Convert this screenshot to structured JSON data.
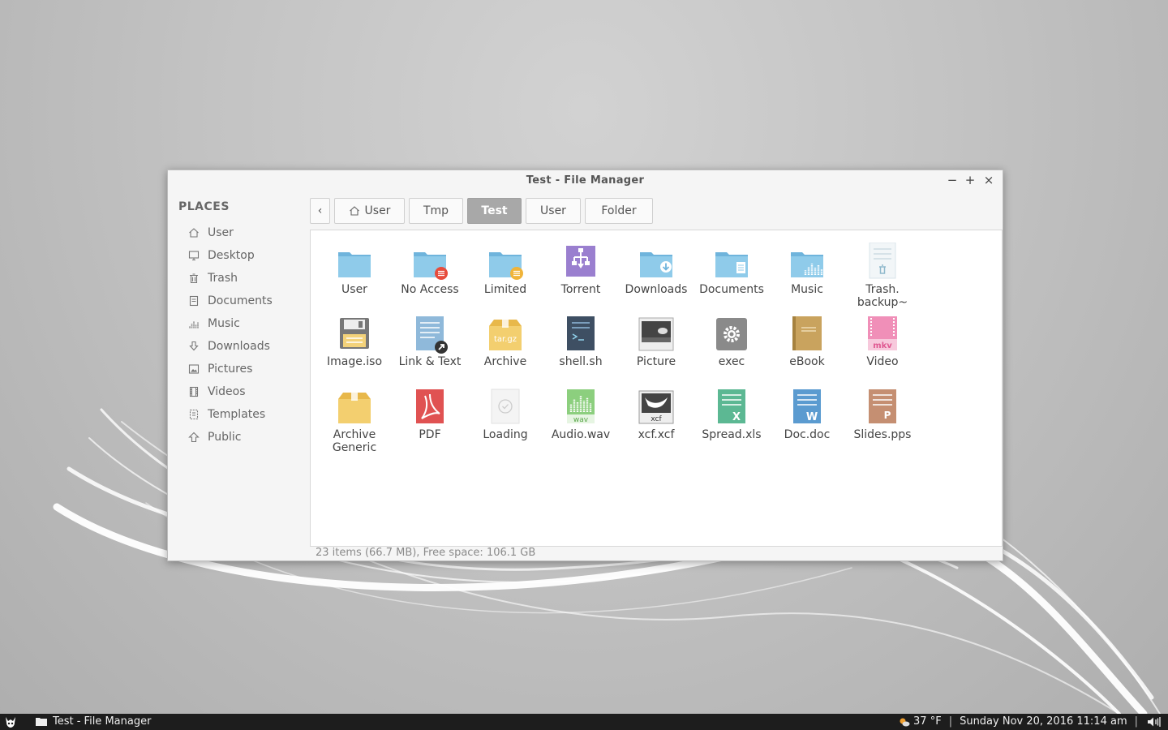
{
  "window": {
    "title": "Test - File Manager",
    "controls": {
      "minimize": "−",
      "maximize": "+",
      "close": "×"
    }
  },
  "sidebar": {
    "heading": "PLACES",
    "items": [
      {
        "label": "User",
        "icon": "home-icon"
      },
      {
        "label": "Desktop",
        "icon": "desktop-icon"
      },
      {
        "label": "Trash",
        "icon": "trash-icon"
      },
      {
        "label": "Documents",
        "icon": "documents-icon"
      },
      {
        "label": "Music",
        "icon": "music-icon"
      },
      {
        "label": "Downloads",
        "icon": "download-icon"
      },
      {
        "label": "Pictures",
        "icon": "pictures-icon"
      },
      {
        "label": "Videos",
        "icon": "videos-icon"
      },
      {
        "label": "Templates",
        "icon": "templates-icon"
      },
      {
        "label": "Public",
        "icon": "public-icon"
      }
    ]
  },
  "pathbar": {
    "back": "‹",
    "crumbs": [
      "User",
      "Tmp",
      "Test",
      "User",
      "Folder"
    ],
    "active": "Test"
  },
  "files": [
    {
      "label": "User",
      "icon": "folder-icon"
    },
    {
      "label": "No Access",
      "icon": "folder-no-access-icon"
    },
    {
      "label": "Limited",
      "icon": "folder-limited-icon"
    },
    {
      "label": "Torrent",
      "icon": "torrent-icon"
    },
    {
      "label": "Downloads",
      "icon": "folder-downloads-icon"
    },
    {
      "label": "Documents",
      "icon": "folder-documents-icon"
    },
    {
      "label": "Music",
      "icon": "folder-music-icon"
    },
    {
      "label": "Trash.\nbackup~",
      "icon": "trash-backup-icon"
    },
    {
      "label": "Image.iso",
      "icon": "disk-image-icon"
    },
    {
      "label": "Link & Text",
      "icon": "text-link-icon"
    },
    {
      "label": "Archive",
      "icon": "archive-targz-icon"
    },
    {
      "label": "shell.sh",
      "icon": "shell-script-icon"
    },
    {
      "label": "Picture",
      "icon": "picture-icon"
    },
    {
      "label": "exec",
      "icon": "executable-icon"
    },
    {
      "label": "eBook",
      "icon": "ebook-icon"
    },
    {
      "label": "Video",
      "icon": "video-mkv-icon"
    },
    {
      "label": "Archive\nGeneric",
      "icon": "archive-generic-icon"
    },
    {
      "label": "PDF",
      "icon": "pdf-icon"
    },
    {
      "label": "Loading",
      "icon": "loading-icon"
    },
    {
      "label": "Audio.wav",
      "icon": "audio-wav-icon"
    },
    {
      "label": "xcf.xcf",
      "icon": "xcf-icon"
    },
    {
      "label": "Spread.xls",
      "icon": "spreadsheet-icon"
    },
    {
      "label": "Doc.doc",
      "icon": "word-doc-icon"
    },
    {
      "label": "Slides.pps",
      "icon": "slides-icon"
    }
  ],
  "icon_text": {
    "targz": "tar.gz",
    "mkv": "mkv",
    "wav": "wav",
    "xcf": "xcf",
    "xls": "X",
    "doc": "W",
    "pps": "P"
  },
  "status": "23 items (66.7 MB), Free space: 106.1 GB",
  "taskbar": {
    "task": "Test - File Manager",
    "weather": "37 °F",
    "separator": "|",
    "datetime": "Sunday Nov 20, 2016 11:14 am"
  },
  "colors": {
    "folder": "#8fcbea",
    "folder_dark": "#6fb4dc",
    "active_crumb": "#a8a8a8",
    "taskbar": "#1d1d1d"
  }
}
